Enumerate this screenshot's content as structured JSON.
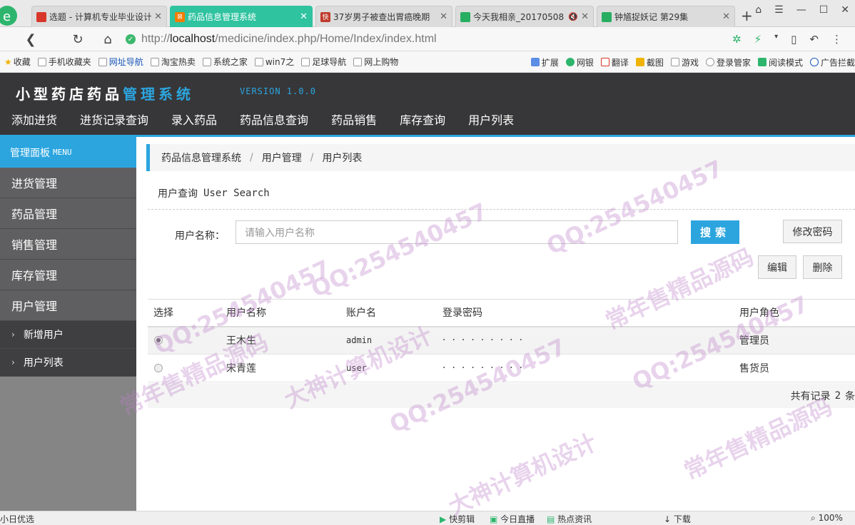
{
  "browser": {
    "tabs": [
      {
        "title": "选题 - 计算机专业毕业设计",
        "favicon_color": "#d9362b",
        "favicon_glyph": "",
        "active": false
      },
      {
        "title": "药品信息管理系统",
        "favicon_color": "#f57c00",
        "favicon_glyph": "⊠",
        "active": true
      },
      {
        "title": "37岁男子被查出胃癌晚期",
        "favicon_color": "#c0392b",
        "favicon_glyph": "快",
        "active": false
      },
      {
        "title": "今天我相亲_20170508",
        "favicon_color": "#27ae60",
        "favicon_glyph": "",
        "active": false
      },
      {
        "title": "钟馗捉妖记 第29集",
        "favicon_color": "#27ae60",
        "favicon_glyph": "",
        "active": false
      }
    ],
    "new_tab_label": "+",
    "url_prefix": "http://",
    "url_host": "localhost",
    "url_path": "/medicine/index.php/Home/Index/index.html",
    "bookmarks": [
      "收藏",
      "手机收藏夹",
      "网址导航",
      "淘宝热卖",
      "系统之家",
      "win7之",
      "足球导航",
      "网上购物"
    ],
    "bookmarks_right": [
      "扩展",
      "网银",
      "翻译",
      "截图",
      "游戏",
      "登录管家",
      "阅读模式",
      "广告拦截"
    ]
  },
  "app": {
    "logo_part1": "小型药店药品",
    "logo_part2": "管理系统",
    "version": "VERSION 1.0.0",
    "top_nav": [
      "添加进货",
      "进货记录查询",
      "录入药品",
      "药品信息查询",
      "药品销售",
      "库存查询",
      "用户列表"
    ]
  },
  "sidebar": {
    "head": "管理面板",
    "head_en": "MENU",
    "items": [
      "进货管理",
      "药品管理",
      "销售管理",
      "库存管理",
      "用户管理"
    ],
    "sub_items": [
      "新增用户",
      "用户列表"
    ]
  },
  "breadcrumb": [
    "药品信息管理系统",
    "用户管理",
    "用户列表"
  ],
  "panel": {
    "title": "用户查询",
    "title_en": "User Search",
    "user_label": "用户名称：",
    "search_placeholder": "请输入用户名称",
    "search_button": "搜索",
    "change_password_button": "修改密码",
    "edit_button": "编辑",
    "delete_button": "删除"
  },
  "table": {
    "headers": [
      "选择",
      "用户名称",
      "账户名",
      "登录密码",
      "用户角色"
    ],
    "rows": [
      {
        "selected": true,
        "name": "王木生",
        "account": "admin",
        "password": "·········",
        "role": "管理员"
      },
      {
        "selected": false,
        "name": "宋青莲",
        "account": "user",
        "password": "·········",
        "role": "售货员"
      }
    ],
    "count_prefix": "共有记录",
    "count_value": "2",
    "count_suffix": "条"
  },
  "statusbar": {
    "left": "小日优选",
    "items": [
      "快剪辑",
      "今日直播",
      "热点资讯",
      "下载"
    ],
    "zoom": "100%"
  },
  "watermark": {
    "texts": [
      "QQ:254540457",
      "常年售精品源码",
      "大神计算机设计"
    ],
    "color": "#c79bd0"
  },
  "colors": {
    "accent": "#2ca5df",
    "header_bg": "#373739",
    "sidebar_bg": "#5f5f61"
  }
}
